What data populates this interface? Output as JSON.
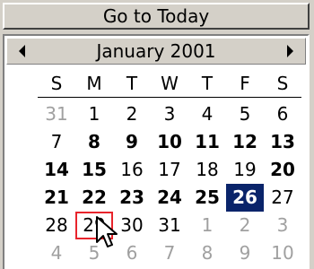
{
  "today_button": {
    "label": "Go to Today"
  },
  "calendar": {
    "month_label": "January 2001",
    "weekdays": [
      "S",
      "M",
      "T",
      "W",
      "T",
      "F",
      "S"
    ],
    "weeks": [
      [
        {
          "label": "31",
          "other_month": true,
          "bold": false
        },
        {
          "label": "1",
          "other_month": false,
          "bold": false
        },
        {
          "label": "2",
          "other_month": false,
          "bold": false
        },
        {
          "label": "3",
          "other_month": false,
          "bold": false
        },
        {
          "label": "4",
          "other_month": false,
          "bold": false
        },
        {
          "label": "5",
          "other_month": false,
          "bold": false
        },
        {
          "label": "6",
          "other_month": false,
          "bold": false
        }
      ],
      [
        {
          "label": "7",
          "other_month": false,
          "bold": false
        },
        {
          "label": "8",
          "other_month": false,
          "bold": true
        },
        {
          "label": "9",
          "other_month": false,
          "bold": true
        },
        {
          "label": "10",
          "other_month": false,
          "bold": true
        },
        {
          "label": "11",
          "other_month": false,
          "bold": true
        },
        {
          "label": "12",
          "other_month": false,
          "bold": true
        },
        {
          "label": "13",
          "other_month": false,
          "bold": true
        }
      ],
      [
        {
          "label": "14",
          "other_month": false,
          "bold": true
        },
        {
          "label": "15",
          "other_month": false,
          "bold": true
        },
        {
          "label": "16",
          "other_month": false,
          "bold": false
        },
        {
          "label": "17",
          "other_month": false,
          "bold": false
        },
        {
          "label": "18",
          "other_month": false,
          "bold": false
        },
        {
          "label": "19",
          "other_month": false,
          "bold": false
        },
        {
          "label": "20",
          "other_month": false,
          "bold": true
        }
      ],
      [
        {
          "label": "21",
          "other_month": false,
          "bold": true
        },
        {
          "label": "22",
          "other_month": false,
          "bold": true
        },
        {
          "label": "23",
          "other_month": false,
          "bold": true
        },
        {
          "label": "24",
          "other_month": false,
          "bold": true
        },
        {
          "label": "25",
          "other_month": false,
          "bold": true
        },
        {
          "label": "26",
          "other_month": false,
          "bold": true,
          "selected": true
        },
        {
          "label": "27",
          "other_month": false,
          "bold": false
        }
      ],
      [
        {
          "label": "28",
          "other_month": false,
          "bold": false
        },
        {
          "label": "29",
          "other_month": false,
          "bold": false,
          "today": true
        },
        {
          "label": "30",
          "other_month": false,
          "bold": false
        },
        {
          "label": "31",
          "other_month": false,
          "bold": false
        },
        {
          "label": "1",
          "other_month": true,
          "bold": false
        },
        {
          "label": "2",
          "other_month": true,
          "bold": false
        },
        {
          "label": "3",
          "other_month": true,
          "bold": false
        }
      ],
      [
        {
          "label": "4",
          "other_month": true,
          "bold": false
        },
        {
          "label": "5",
          "other_month": true,
          "bold": false
        },
        {
          "label": "6",
          "other_month": true,
          "bold": false
        },
        {
          "label": "7",
          "other_month": true,
          "bold": false
        },
        {
          "label": "8",
          "other_month": true,
          "bold": false
        },
        {
          "label": "9",
          "other_month": true,
          "bold": false
        },
        {
          "label": "10",
          "other_month": true,
          "bold": false
        }
      ]
    ]
  },
  "colors": {
    "selected_bg": "#0a246a",
    "today_border": "#e8242c",
    "other_month_text": "#a0a0a0"
  },
  "icons": {
    "prev_month": "left-arrow-icon",
    "next_month": "right-arrow-icon",
    "cursor": "mouse-pointer-icon"
  }
}
